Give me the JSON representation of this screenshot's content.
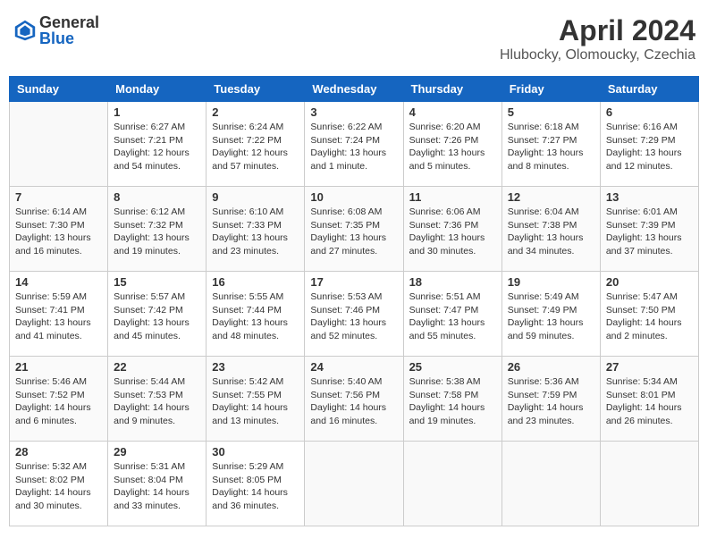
{
  "header": {
    "logo_general": "General",
    "logo_blue": "Blue",
    "month": "April 2024",
    "location": "Hlubocky, Olomoucky, Czechia"
  },
  "weekdays": [
    "Sunday",
    "Monday",
    "Tuesday",
    "Wednesday",
    "Thursday",
    "Friday",
    "Saturday"
  ],
  "weeks": [
    [
      {
        "day": "",
        "info": ""
      },
      {
        "day": "1",
        "info": "Sunrise: 6:27 AM\nSunset: 7:21 PM\nDaylight: 12 hours\nand 54 minutes."
      },
      {
        "day": "2",
        "info": "Sunrise: 6:24 AM\nSunset: 7:22 PM\nDaylight: 12 hours\nand 57 minutes."
      },
      {
        "day": "3",
        "info": "Sunrise: 6:22 AM\nSunset: 7:24 PM\nDaylight: 13 hours\nand 1 minute."
      },
      {
        "day": "4",
        "info": "Sunrise: 6:20 AM\nSunset: 7:26 PM\nDaylight: 13 hours\nand 5 minutes."
      },
      {
        "day": "5",
        "info": "Sunrise: 6:18 AM\nSunset: 7:27 PM\nDaylight: 13 hours\nand 8 minutes."
      },
      {
        "day": "6",
        "info": "Sunrise: 6:16 AM\nSunset: 7:29 PM\nDaylight: 13 hours\nand 12 minutes."
      }
    ],
    [
      {
        "day": "7",
        "info": "Sunrise: 6:14 AM\nSunset: 7:30 PM\nDaylight: 13 hours\nand 16 minutes."
      },
      {
        "day": "8",
        "info": "Sunrise: 6:12 AM\nSunset: 7:32 PM\nDaylight: 13 hours\nand 19 minutes."
      },
      {
        "day": "9",
        "info": "Sunrise: 6:10 AM\nSunset: 7:33 PM\nDaylight: 13 hours\nand 23 minutes."
      },
      {
        "day": "10",
        "info": "Sunrise: 6:08 AM\nSunset: 7:35 PM\nDaylight: 13 hours\nand 27 minutes."
      },
      {
        "day": "11",
        "info": "Sunrise: 6:06 AM\nSunset: 7:36 PM\nDaylight: 13 hours\nand 30 minutes."
      },
      {
        "day": "12",
        "info": "Sunrise: 6:04 AM\nSunset: 7:38 PM\nDaylight: 13 hours\nand 34 minutes."
      },
      {
        "day": "13",
        "info": "Sunrise: 6:01 AM\nSunset: 7:39 PM\nDaylight: 13 hours\nand 37 minutes."
      }
    ],
    [
      {
        "day": "14",
        "info": "Sunrise: 5:59 AM\nSunset: 7:41 PM\nDaylight: 13 hours\nand 41 minutes."
      },
      {
        "day": "15",
        "info": "Sunrise: 5:57 AM\nSunset: 7:42 PM\nDaylight: 13 hours\nand 45 minutes."
      },
      {
        "day": "16",
        "info": "Sunrise: 5:55 AM\nSunset: 7:44 PM\nDaylight: 13 hours\nand 48 minutes."
      },
      {
        "day": "17",
        "info": "Sunrise: 5:53 AM\nSunset: 7:46 PM\nDaylight: 13 hours\nand 52 minutes."
      },
      {
        "day": "18",
        "info": "Sunrise: 5:51 AM\nSunset: 7:47 PM\nDaylight: 13 hours\nand 55 minutes."
      },
      {
        "day": "19",
        "info": "Sunrise: 5:49 AM\nSunset: 7:49 PM\nDaylight: 13 hours\nand 59 minutes."
      },
      {
        "day": "20",
        "info": "Sunrise: 5:47 AM\nSunset: 7:50 PM\nDaylight: 14 hours\nand 2 minutes."
      }
    ],
    [
      {
        "day": "21",
        "info": "Sunrise: 5:46 AM\nSunset: 7:52 PM\nDaylight: 14 hours\nand 6 minutes."
      },
      {
        "day": "22",
        "info": "Sunrise: 5:44 AM\nSunset: 7:53 PM\nDaylight: 14 hours\nand 9 minutes."
      },
      {
        "day": "23",
        "info": "Sunrise: 5:42 AM\nSunset: 7:55 PM\nDaylight: 14 hours\nand 13 minutes."
      },
      {
        "day": "24",
        "info": "Sunrise: 5:40 AM\nSunset: 7:56 PM\nDaylight: 14 hours\nand 16 minutes."
      },
      {
        "day": "25",
        "info": "Sunrise: 5:38 AM\nSunset: 7:58 PM\nDaylight: 14 hours\nand 19 minutes."
      },
      {
        "day": "26",
        "info": "Sunrise: 5:36 AM\nSunset: 7:59 PM\nDaylight: 14 hours\nand 23 minutes."
      },
      {
        "day": "27",
        "info": "Sunrise: 5:34 AM\nSunset: 8:01 PM\nDaylight: 14 hours\nand 26 minutes."
      }
    ],
    [
      {
        "day": "28",
        "info": "Sunrise: 5:32 AM\nSunset: 8:02 PM\nDaylight: 14 hours\nand 30 minutes."
      },
      {
        "day": "29",
        "info": "Sunrise: 5:31 AM\nSunset: 8:04 PM\nDaylight: 14 hours\nand 33 minutes."
      },
      {
        "day": "30",
        "info": "Sunrise: 5:29 AM\nSunset: 8:05 PM\nDaylight: 14 hours\nand 36 minutes."
      },
      {
        "day": "",
        "info": ""
      },
      {
        "day": "",
        "info": ""
      },
      {
        "day": "",
        "info": ""
      },
      {
        "day": "",
        "info": ""
      }
    ]
  ]
}
